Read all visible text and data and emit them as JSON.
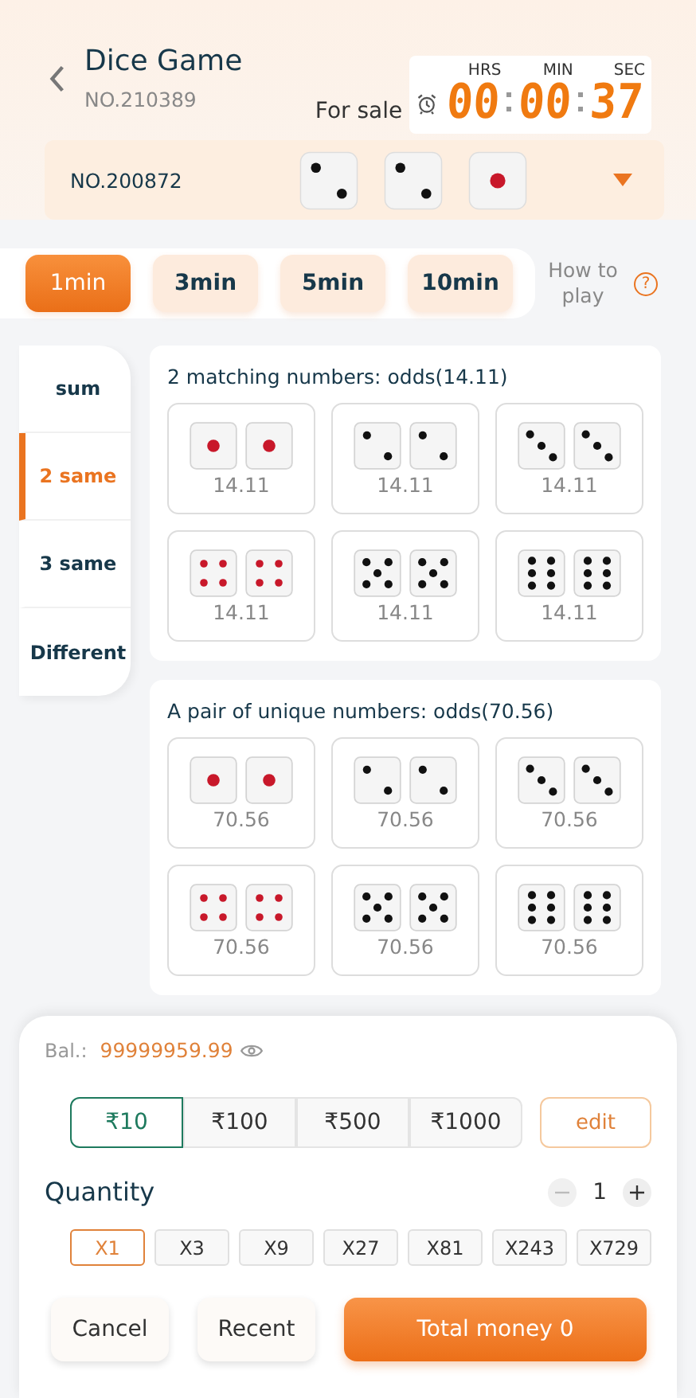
{
  "header": {
    "title": "Dice Game",
    "issue": "NO.210389",
    "status": "For sale",
    "timer": {
      "labels": [
        "HRS",
        "MIN",
        "SEC"
      ],
      "digits": [
        "00",
        "00",
        "37"
      ]
    }
  },
  "last_result": {
    "issue": "NO.200872",
    "dice": [
      {
        "kind": "two"
      },
      {
        "kind": "two"
      },
      {
        "kind": "one"
      }
    ]
  },
  "durations": [
    {
      "label": "1min",
      "selected": true
    },
    {
      "label": "3min",
      "selected": false
    },
    {
      "label": "5min",
      "selected": false
    },
    {
      "label": "10min",
      "selected": false
    }
  ],
  "help": {
    "label": "How to play",
    "icon": "?"
  },
  "sidebar": {
    "items": [
      {
        "label": "sum",
        "selected": false
      },
      {
        "label": "2 same",
        "selected": true
      },
      {
        "label": "3 same",
        "selected": false
      },
      {
        "label": "Different",
        "selected": false
      }
    ]
  },
  "sections": [
    {
      "title": "2 matching numbers: odds(14.11)",
      "options": [
        {
          "kind": "one",
          "odds": "14.11"
        },
        {
          "kind": "two",
          "odds": "14.11"
        },
        {
          "kind": "three",
          "odds": "14.11"
        },
        {
          "kind": "four",
          "odds": "14.11"
        },
        {
          "kind": "five",
          "odds": "14.11"
        },
        {
          "kind": "six",
          "odds": "14.11"
        }
      ]
    },
    {
      "title": "A pair of unique numbers: odds(70.56)",
      "options": [
        {
          "kind": "one",
          "odds": "70.56"
        },
        {
          "kind": "two",
          "odds": "70.56"
        },
        {
          "kind": "three",
          "odds": "70.56"
        },
        {
          "kind": "four",
          "odds": "70.56"
        },
        {
          "kind": "five",
          "odds": "70.56"
        },
        {
          "kind": "six",
          "odds": "70.56"
        }
      ]
    }
  ],
  "bet": {
    "balance_label": "Bal.:",
    "balance": "99999959.99",
    "amounts": [
      {
        "label": "₹10",
        "selected": true
      },
      {
        "label": "₹100",
        "selected": false
      },
      {
        "label": "₹500",
        "selected": false
      },
      {
        "label": "₹1000",
        "selected": false
      }
    ],
    "edit": "edit",
    "quantity_label": "Quantity",
    "quantity": "1",
    "multipliers": [
      {
        "label": "X1",
        "selected": true
      },
      {
        "label": "X3",
        "selected": false
      },
      {
        "label": "X9",
        "selected": false
      },
      {
        "label": "X27",
        "selected": false
      },
      {
        "label": "X81",
        "selected": false
      },
      {
        "label": "X243",
        "selected": false
      },
      {
        "label": "X729",
        "selected": false
      }
    ],
    "cancel": "Cancel",
    "recent": "Recent",
    "total": "Total money 0"
  }
}
